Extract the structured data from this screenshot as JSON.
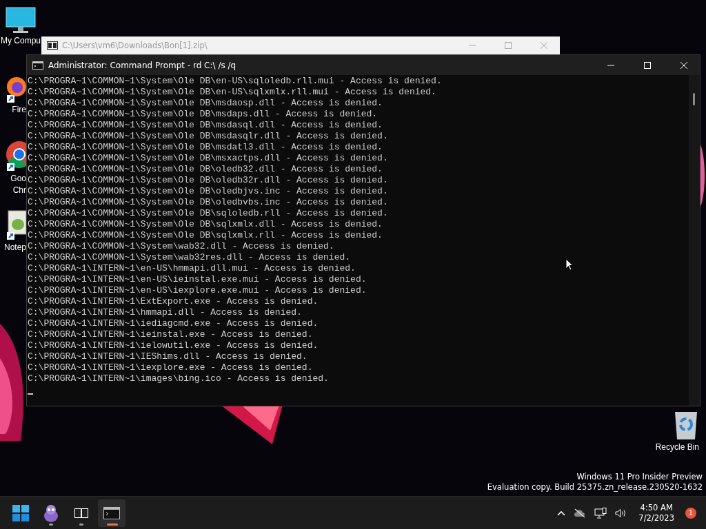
{
  "desktop_icons": [
    {
      "kind": "computer",
      "label_lines": [
        "My Compu"
      ]
    },
    {
      "kind": "firefox",
      "label_lines": [
        "Fire"
      ]
    },
    {
      "kind": "chrome",
      "label_lines": [
        "Goo",
        "Chr"
      ]
    },
    {
      "kind": "notepad",
      "label_lines": [
        "Notep"
      ]
    },
    {
      "kind": "recycle",
      "label_lines": [
        "Recycle Bin"
      ]
    }
  ],
  "background_window": {
    "title": "C:\\Users\\vm6\\Downloads\\Bon[1].zip\\"
  },
  "console": {
    "title": "Administrator:  Command Prompt - rd  C:\\ /s /q",
    "lines": [
      "C:\\PROGRA~1\\COMMON~1\\System\\Ole DB\\en-US\\sqloledb.rll.mui - Access is denied.",
      "C:\\PROGRA~1\\COMMON~1\\System\\Ole DB\\en-US\\sqlxmlx.rll.mui - Access is denied.",
      "C:\\PROGRA~1\\COMMON~1\\System\\Ole DB\\msdaosp.dll - Access is denied.",
      "C:\\PROGRA~1\\COMMON~1\\System\\Ole DB\\msdaps.dll - Access is denied.",
      "C:\\PROGRA~1\\COMMON~1\\System\\Ole DB\\msdasql.dll - Access is denied.",
      "C:\\PROGRA~1\\COMMON~1\\System\\Ole DB\\msdasqlr.dll - Access is denied.",
      "C:\\PROGRA~1\\COMMON~1\\System\\Ole DB\\msdatl3.dll - Access is denied.",
      "C:\\PROGRA~1\\COMMON~1\\System\\Ole DB\\msxactps.dll - Access is denied.",
      "C:\\PROGRA~1\\COMMON~1\\System\\Ole DB\\oledb32.dll - Access is denied.",
      "C:\\PROGRA~1\\COMMON~1\\System\\Ole DB\\oledb32r.dll - Access is denied.",
      "C:\\PROGRA~1\\COMMON~1\\System\\Ole DB\\oledbjvs.inc - Access is denied.",
      "C:\\PROGRA~1\\COMMON~1\\System\\Ole DB\\oledbvbs.inc - Access is denied.",
      "C:\\PROGRA~1\\COMMON~1\\System\\Ole DB\\sqloledb.rll - Access is denied.",
      "C:\\PROGRA~1\\COMMON~1\\System\\Ole DB\\sqlxmlx.dll - Access is denied.",
      "C:\\PROGRA~1\\COMMON~1\\System\\Ole DB\\sqlxmlx.rll - Access is denied.",
      "C:\\PROGRA~1\\COMMON~1\\System\\wab32.dll - Access is denied.",
      "C:\\PROGRA~1\\COMMON~1\\System\\wab32res.dll - Access is denied.",
      "C:\\PROGRA~1\\INTERN~1\\en-US\\hmmapi.dll.mui - Access is denied.",
      "C:\\PROGRA~1\\INTERN~1\\en-US\\ieinstal.exe.mui - Access is denied.",
      "C:\\PROGRA~1\\INTERN~1\\en-US\\iexplore.exe.mui - Access is denied.",
      "C:\\PROGRA~1\\INTERN~1\\ExtExport.exe - Access is denied.",
      "C:\\PROGRA~1\\INTERN~1\\hmmapi.dll - Access is denied.",
      "C:\\PROGRA~1\\INTERN~1\\iediagcmd.exe - Access is denied.",
      "C:\\PROGRA~1\\INTERN~1\\ieinstal.exe - Access is denied.",
      "C:\\PROGRA~1\\INTERN~1\\ielowutil.exe - Access is denied.",
      "C:\\PROGRA~1\\INTERN~1\\IEShims.dll - Access is denied.",
      "C:\\PROGRA~1\\INTERN~1\\iexplore.exe - Access is denied.",
      "C:\\PROGRA~1\\INTERN~1\\images\\bing.ico - Access is denied."
    ]
  },
  "watermark": [
    "Windows 11 Pro Insider Preview",
    "Evaluation copy. Build 25375.zn_release.230520-1632"
  ],
  "taskbar": {
    "apps": [
      {
        "kind": "start",
        "running": false,
        "selected": false
      },
      {
        "kind": "creature",
        "running": true,
        "selected": false
      },
      {
        "kind": "sevenzip",
        "running": true,
        "selected": false
      },
      {
        "kind": "console",
        "running": true,
        "selected": true
      }
    ],
    "time": "4:50 AM",
    "date": "7/2/2023",
    "notification_count": "1"
  }
}
